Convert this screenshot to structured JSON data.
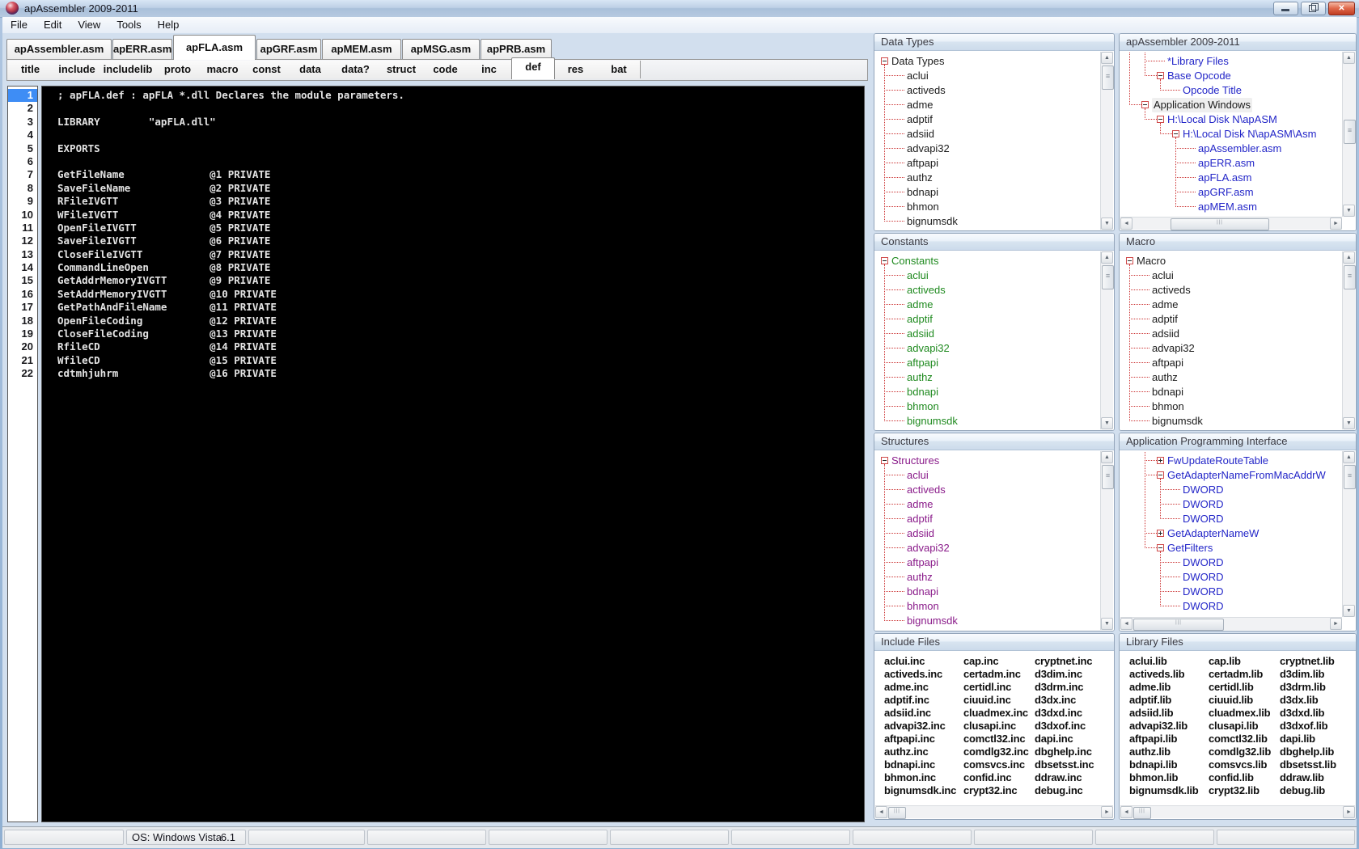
{
  "window": {
    "title": "apAssembler 2009-2011",
    "controls": {
      "minimize": "minimize",
      "restore": "restore",
      "close": "close"
    },
    "status": {
      "os_label": "OS: Windows Vista",
      "os_version": "6.1"
    }
  },
  "menu": [
    "File",
    "Edit",
    "View",
    "Tools",
    "Help"
  ],
  "file_tabs": {
    "active": "apFLA.asm",
    "items": [
      "apAssembler.asm",
      "apERR.asm",
      "apFLA.asm",
      "apGRF.asm",
      "apMEM.asm",
      "apMSG.asm",
      "apPRB.asm"
    ]
  },
  "section_tabs": {
    "active": "def",
    "items": [
      "title",
      "include",
      "includelib",
      "proto",
      "macro",
      "const",
      "data",
      "data?",
      "struct",
      "code",
      "inc",
      "def",
      "res",
      "bat"
    ]
  },
  "editor": {
    "selected_line": 1,
    "lines": [
      "; apFLA.def : apFLA *.dll Declares the module parameters.",
      "",
      "LIBRARY        \"apFLA.dll\"",
      "",
      "EXPORTS",
      "",
      "GetFileName              @1 PRIVATE",
      "SaveFileName             @2 PRIVATE",
      "RFileIVGTT               @3 PRIVATE",
      "WFileIVGTT               @4 PRIVATE",
      "OpenFileIVGTT            @5 PRIVATE",
      "SaveFileIVGTT            @6 PRIVATE",
      "CloseFileIVGTT           @7 PRIVATE",
      "CommandLineOpen          @8 PRIVATE",
      "GetAddrMemoryIVGTT       @9 PRIVATE",
      "SetAddrMemoryIVGTT       @10 PRIVATE",
      "GetPathAndFileName       @11 PRIVATE",
      "OpenFileCoding           @12 PRIVATE",
      "CloseFileCoding          @13 PRIVATE",
      "RfileCD                  @14 PRIVATE",
      "WfileCD                  @15 PRIVATE",
      "cdtmhjuhrm               @16 PRIVATE"
    ]
  },
  "panels": {
    "data_types": {
      "header": "Data Types",
      "text_color": "#1b1b1b",
      "items": [
        {
          "l": "Data Types",
          "d": 0,
          "b": "m"
        },
        {
          "l": "aclui",
          "d": 1
        },
        {
          "l": "activeds",
          "d": 1
        },
        {
          "l": "adme",
          "d": 1
        },
        {
          "l": "adptif",
          "d": 1
        },
        {
          "l": "adsiid",
          "d": 1
        },
        {
          "l": "advapi32",
          "d": 1
        },
        {
          "l": "aftpapi",
          "d": 1
        },
        {
          "l": "authz",
          "d": 1
        },
        {
          "l": "bdnapi",
          "d": 1
        },
        {
          "l": "bhmon",
          "d": 1
        },
        {
          "l": "bignumsdk",
          "d": 1
        }
      ]
    },
    "assembler": {
      "header": "apAssembler 2009-2011",
      "text_color": "#2326c8",
      "items": [
        {
          "l": "*Library Files",
          "d": 2
        },
        {
          "l": "Base Opcode",
          "d": 2,
          "b": "m"
        },
        {
          "l": "Opcode Title",
          "d": 3
        },
        {
          "l": "Application Windows",
          "d": 1,
          "b": "m",
          "c": "#1b1b1b",
          "sel": true
        },
        {
          "l": "H:\\Local Disk N\\apASM",
          "d": 2,
          "b": "m"
        },
        {
          "l": "H:\\Local Disk N\\apASM\\Asm",
          "d": 3,
          "b": "m"
        },
        {
          "l": "apAssembler.asm",
          "d": 4
        },
        {
          "l": "apERR.asm",
          "d": 4
        },
        {
          "l": "apFLA.asm",
          "d": 4
        },
        {
          "l": "apGRF.asm",
          "d": 4
        },
        {
          "l": "apMEM.asm",
          "d": 4
        }
      ]
    },
    "constants": {
      "header": "Constants",
      "text_color": "#1f8a1f",
      "items": [
        {
          "l": "Constants",
          "d": 0,
          "b": "m"
        },
        {
          "l": "aclui",
          "d": 1
        },
        {
          "l": "activeds",
          "d": 1
        },
        {
          "l": "adme",
          "d": 1
        },
        {
          "l": "adptif",
          "d": 1
        },
        {
          "l": "adsiid",
          "d": 1
        },
        {
          "l": "advapi32",
          "d": 1
        },
        {
          "l": "aftpapi",
          "d": 1
        },
        {
          "l": "authz",
          "d": 1
        },
        {
          "l": "bdnapi",
          "d": 1
        },
        {
          "l": "bhmon",
          "d": 1
        },
        {
          "l": "bignumsdk",
          "d": 1
        }
      ]
    },
    "macro": {
      "header": "Macro",
      "text_color": "#1b1b1b",
      "items": [
        {
          "l": "Macro",
          "d": 0,
          "b": "m"
        },
        {
          "l": "aclui",
          "d": 1
        },
        {
          "l": "activeds",
          "d": 1
        },
        {
          "l": "adme",
          "d": 1
        },
        {
          "l": "adptif",
          "d": 1
        },
        {
          "l": "adsiid",
          "d": 1
        },
        {
          "l": "advapi32",
          "d": 1
        },
        {
          "l": "aftpapi",
          "d": 1
        },
        {
          "l": "authz",
          "d": 1
        },
        {
          "l": "bdnapi",
          "d": 1
        },
        {
          "l": "bhmon",
          "d": 1
        },
        {
          "l": "bignumsdk",
          "d": 1
        }
      ]
    },
    "structures": {
      "header": "Structures",
      "text_color": "#8a1b8a",
      "items": [
        {
          "l": "Structures",
          "d": 0,
          "b": "m"
        },
        {
          "l": "aclui",
          "d": 1
        },
        {
          "l": "activeds",
          "d": 1
        },
        {
          "l": "adme",
          "d": 1
        },
        {
          "l": "adptif",
          "d": 1
        },
        {
          "l": "adsiid",
          "d": 1
        },
        {
          "l": "advapi32",
          "d": 1
        },
        {
          "l": "aftpapi",
          "d": 1
        },
        {
          "l": "authz",
          "d": 1
        },
        {
          "l": "bdnapi",
          "d": 1
        },
        {
          "l": "bhmon",
          "d": 1
        },
        {
          "l": "bignumsdk",
          "d": 1
        }
      ]
    },
    "api": {
      "header": "Application Programming Interface",
      "text_color": "#2326c8",
      "items": [
        {
          "l": "FwUpdateRouteTable",
          "d": 2,
          "b": "p"
        },
        {
          "l": "GetAdapterNameFromMacAddrW",
          "d": 2,
          "b": "m"
        },
        {
          "l": "DWORD",
          "d": 3
        },
        {
          "l": "DWORD",
          "d": 3
        },
        {
          "l": "DWORD",
          "d": 3
        },
        {
          "l": "GetAdapterNameW",
          "d": 2,
          "b": "p"
        },
        {
          "l": "GetFilters",
          "d": 2,
          "b": "m"
        },
        {
          "l": "DWORD",
          "d": 3
        },
        {
          "l": "DWORD",
          "d": 3
        },
        {
          "l": "DWORD",
          "d": 3
        },
        {
          "l": "DWORD",
          "d": 3
        }
      ]
    },
    "include_files": {
      "header": "Include Files",
      "columns": [
        [
          "aclui.inc",
          "activeds.inc",
          "adme.inc",
          "adptif.inc",
          "adsiid.inc",
          "advapi32.inc",
          "aftpapi.inc",
          "authz.inc",
          "bdnapi.inc",
          "bhmon.inc",
          "bignumsdk.inc"
        ],
        [
          "cap.inc",
          "certadm.inc",
          "certidl.inc",
          "ciuuid.inc",
          "cluadmex.inc",
          "clusapi.inc",
          "comctl32.inc",
          "comdlg32.inc",
          "comsvcs.inc",
          "confid.inc",
          "crypt32.inc"
        ],
        [
          "cryptnet.inc",
          "d3dim.inc",
          "d3drm.inc",
          "d3dx.inc",
          "d3dxd.inc",
          "d3dxof.inc",
          "dapi.inc",
          "dbghelp.inc",
          "dbsetsst.inc",
          "ddraw.inc",
          "debug.inc"
        ]
      ]
    },
    "library_files": {
      "header": "Library Files",
      "columns": [
        [
          "aclui.lib",
          "activeds.lib",
          "adme.lib",
          "adptif.lib",
          "adsiid.lib",
          "advapi32.lib",
          "aftpapi.lib",
          "authz.lib",
          "bdnapi.lib",
          "bhmon.lib",
          "bignumsdk.lib"
        ],
        [
          "cap.lib",
          "certadm.lib",
          "certidl.lib",
          "ciuuid.lib",
          "cluadmex.lib",
          "clusapi.lib",
          "comctl32.lib",
          "comdlg32.lib",
          "comsvcs.lib",
          "confid.lib",
          "crypt32.lib"
        ],
        [
          "cryptnet.lib",
          "d3dim.lib",
          "d3drm.lib",
          "d3dx.lib",
          "d3dxd.lib",
          "d3dxof.lib",
          "dapi.lib",
          "dbghelp.lib",
          "dbsetsst.lib",
          "ddraw.lib",
          "debug.lib"
        ]
      ]
    }
  }
}
